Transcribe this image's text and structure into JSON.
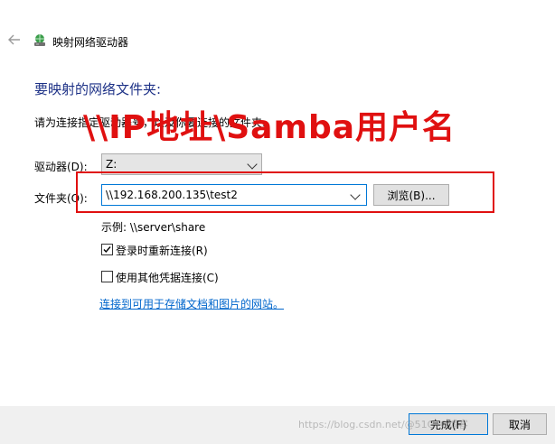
{
  "window": {
    "title": "映射网络驱动器"
  },
  "heading": "要映射的网络文件夹:",
  "instruction": "请为连接指定驱动器号，以及你要连接的文件夹:",
  "drive": {
    "label": "驱动器(D):",
    "value": "Z:"
  },
  "folder": {
    "label": "文件夹(O):",
    "value": "\\\\192.168.200.135\\test2",
    "browse_label": "浏览(B)..."
  },
  "example": "示例: \\\\server\\share",
  "reconnect": {
    "label": "登录时重新连接(R)",
    "checked": true
  },
  "other_credentials": {
    "label": "使用其他凭据连接(C)",
    "checked": false
  },
  "link": "连接到可用于存储文档和图片的网站。",
  "annotation": "\\\\IP地址\\Samba用户名",
  "buttons": {
    "finish": "完成(F)",
    "cancel": "取消"
  },
  "watermark": "https://blog.csdn.net/@51CTO博客",
  "colors": {
    "heading_blue": "#1e3287",
    "link_blue": "#0066cc",
    "annotation_red": "#e01010",
    "focus_blue": "#0078d7"
  },
  "icons": {
    "back": "back-arrow-icon",
    "network_drive": "network-drive-icon"
  }
}
